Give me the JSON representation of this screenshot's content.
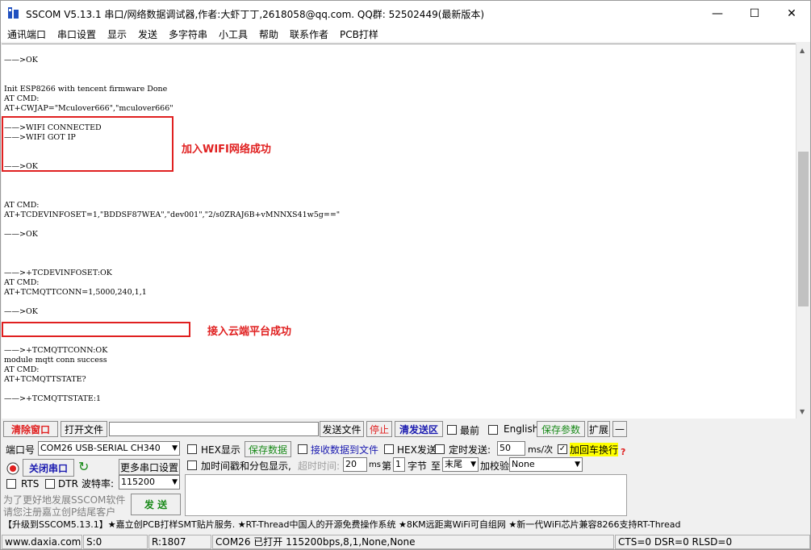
{
  "window": {
    "title": "SSCOM V5.13.1 串口/网络数据调试器,作者:大虾丁丁,2618058@qq.com. QQ群: 52502449(最新版本)"
  },
  "menu": [
    "通讯端口",
    "串口设置",
    "显示",
    "发送",
    "多字符串",
    "小工具",
    "帮助",
    "联系作者",
    "PCB打样"
  ],
  "terminal": {
    "lines": [
      "——>OK",
      "",
      "",
      "Init ESP8266 with tencent firmware Done",
      "AT CMD:",
      "AT+CWJAP=\"Mculover666\",\"mculover666\"",
      "",
      "——>WIFI CONNECTED",
      "——>WIFI GOT IP",
      "",
      "",
      "——>OK",
      "",
      "",
      "",
      "AT CMD:",
      "AT+TCDEVINFOSET=1,\"BDDSF87WEA\",\"dev001\",\"2/s0ZRAJ6B+vMNNXS41w5g==\"",
      "",
      "——>OK",
      "",
      "",
      "",
      "——>+TCDEVINFOSET:OK",
      "AT CMD:",
      "AT+TCMQTTCONN=1,5000,240,1,1",
      "",
      "——>OK",
      "",
      "",
      "",
      "——>+TCMQTTCONN:OK",
      "module mqtt conn success",
      "AT CMD:",
      "AT+TCMQTTSTATE?",
      "",
      "——>+TCMQTTSTATE:1",
      "",
      "",
      "",
      "——>OK"
    ]
  },
  "annotations": {
    "wifi": "加入WIFI网络成功",
    "cloud": "接入云端平台成功"
  },
  "toolbar": {
    "clear": "清除窗口",
    "open_file": "打开文件",
    "send_file": "发送文件",
    "stop": "停止",
    "clear_send": "清发送区",
    "last": "最前",
    "english": "English",
    "save_params": "保存参数",
    "expand": "扩展",
    "minus": "—"
  },
  "port": {
    "label": "端口号",
    "value": "COM26 USB-SERIAL CH340",
    "close_port": "关闭串口",
    "more_settings": "更多串口设置",
    "rts": "RTS",
    "dtr": "DTR",
    "baud_label": "波特率:",
    "baud": "115200",
    "promo1": "为了更好地发展SSCOM软件",
    "promo2": "请您注册嘉立创P结尾客户",
    "send": "发 送"
  },
  "options": {
    "hex_display": "HEX显示",
    "save_data": "保存数据",
    "recv_to_file": "接收数据到文件",
    "hex_send": "HEX发送",
    "timed_send": "定时发送:",
    "interval": "50",
    "interval_unit": "ms/次",
    "append_crlf": "加回车换行",
    "timestamp": "加时间戳和分包显示,",
    "timeout_label": "超时时间:",
    "timeout": "20",
    "timeout_unit": "ms",
    "byte_prefix": "第",
    "byte_num": "1",
    "byte_suffix": "字节",
    "to": "至",
    "end": "末尾",
    "checksum_label": "加校验",
    "checksum": "None"
  },
  "ad": "【升级到SSCOM5.13.1】★嘉立创PCB打样SMT贴片服务. ★RT-Thread中国人的开源免费操作系统 ★8KM远距离WiFi可自组网 ★新一代WiFi芯片兼容8266支持RT-Thread",
  "status": {
    "site": "www.daxia.com",
    "s": "S:0",
    "r": "R:1807",
    "port": "COM26 已打开  115200bps,8,1,None,None",
    "lines": "CTS=0 DSR=0 RLSD=0"
  },
  "colors": {
    "accent_red": "#e02020",
    "green": "#1a8a1a",
    "highlight": "#ffff00"
  }
}
